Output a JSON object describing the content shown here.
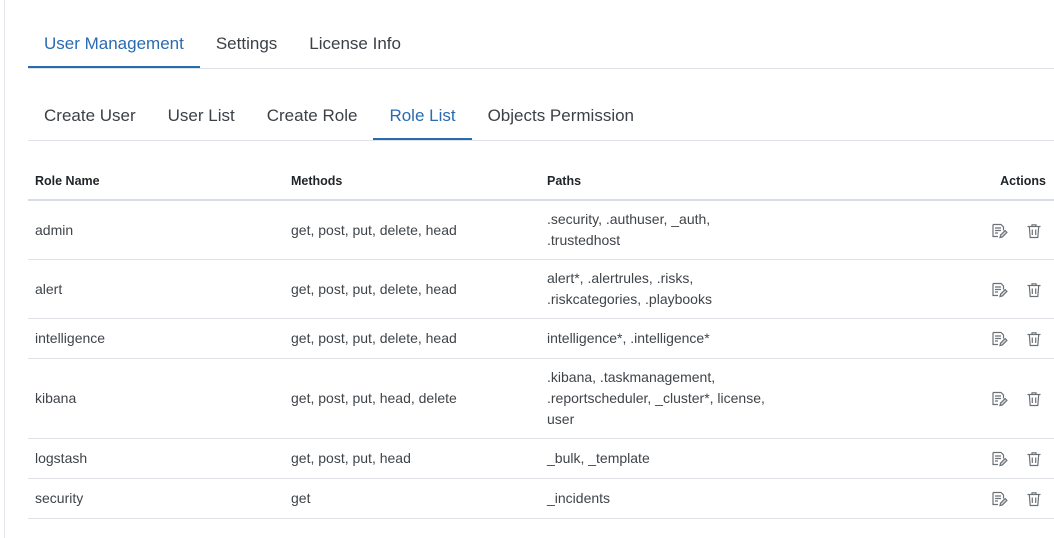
{
  "top_tabs": [
    {
      "label": "User Management",
      "active": true
    },
    {
      "label": "Settings",
      "active": false
    },
    {
      "label": "License Info",
      "active": false
    }
  ],
  "sub_tabs": [
    {
      "label": "Create User",
      "active": false
    },
    {
      "label": "User List",
      "active": false
    },
    {
      "label": "Create Role",
      "active": false
    },
    {
      "label": "Role List",
      "active": true
    },
    {
      "label": "Objects Permission",
      "active": false
    }
  ],
  "table": {
    "headers": {
      "role_name": "Role Name",
      "methods": "Methods",
      "paths": "Paths",
      "actions": "Actions"
    },
    "rows": [
      {
        "role_name": "admin",
        "methods": "get, post, put, delete, head",
        "paths": ".security, .authuser, _auth, .trustedhost"
      },
      {
        "role_name": "alert",
        "methods": "get, post, put, delete, head",
        "paths": "alert*, .alertrules, .risks, .riskcategories, .playbooks"
      },
      {
        "role_name": "intelligence",
        "methods": "get, post, put, delete, head",
        "paths": "intelligence*, .intelligence*"
      },
      {
        "role_name": "kibana",
        "methods": "get, post, put, head, delete",
        "paths": ".kibana, .taskmanagement, .reportscheduler, _cluster*, license, user"
      },
      {
        "role_name": "logstash",
        "methods": "get, post, put, head",
        "paths": "_bulk, _template"
      },
      {
        "role_name": "security",
        "methods": "get",
        "paths": "_incidents"
      }
    ],
    "row_actions": [
      "edit-icon",
      "delete-icon"
    ]
  },
  "colors": {
    "accent": "#2a6bb0",
    "text": "#3f4449",
    "border": "#dfe3e8",
    "icon": "#6b7075"
  }
}
